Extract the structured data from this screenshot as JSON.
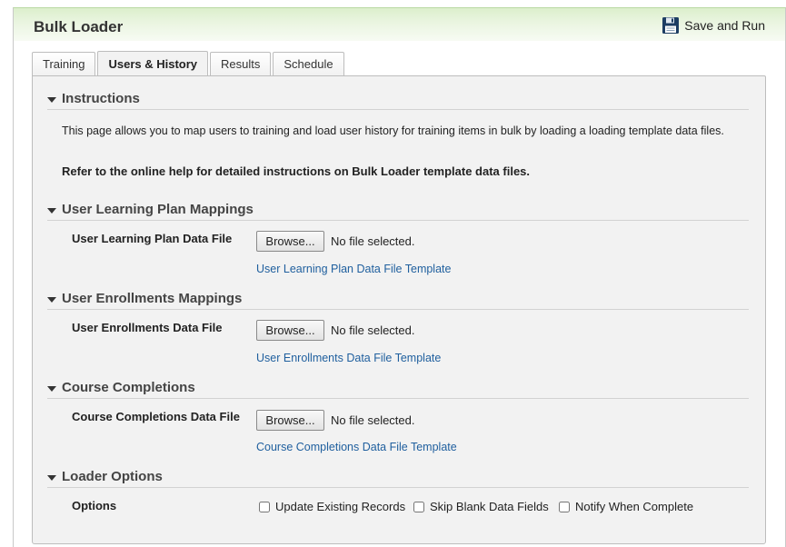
{
  "header": {
    "title": "Bulk Loader",
    "save_run_label": "Save and Run"
  },
  "tabs": [
    {
      "label": "Training"
    },
    {
      "label": "Users & History"
    },
    {
      "label": "Results"
    },
    {
      "label": "Schedule"
    }
  ],
  "instructions": {
    "title": "Instructions",
    "text": "This page allows you to map users to training and load user history for training items in bulk by loading a loading template data files.",
    "note": "Refer to the online help for detailed instructions on Bulk Loader template data files."
  },
  "learning_plan": {
    "title": "User Learning Plan Mappings",
    "field_label": "User Learning Plan Data File",
    "browse_label": "Browse...",
    "file_status": "No file selected.",
    "template_link": "User Learning Plan Data File Template"
  },
  "enrollments": {
    "title": "User Enrollments Mappings",
    "field_label": "User Enrollments Data File",
    "browse_label": "Browse...",
    "file_status": "No file selected.",
    "template_link": "User Enrollments Data File Template"
  },
  "completions": {
    "title": "Course Completions",
    "field_label": "Course Completions Data File",
    "browse_label": "Browse...",
    "file_status": "No file selected.",
    "template_link": "Course Completions Data File Template"
  },
  "loader_options": {
    "title": "Loader Options",
    "field_label": "Options",
    "options": [
      {
        "label": "Update Existing Records",
        "checked": false
      },
      {
        "label": "Skip Blank Data Fields",
        "checked": false
      },
      {
        "label": "Notify When Complete",
        "checked": false
      }
    ]
  },
  "colors": {
    "header_green": "#dcefcc",
    "panel_bg": "#f2f2f2",
    "link_blue": "#1f5f9e"
  },
  "icons": {
    "save_run": "floppy-disk-icon",
    "section_toggle": "triangle-down-icon"
  }
}
